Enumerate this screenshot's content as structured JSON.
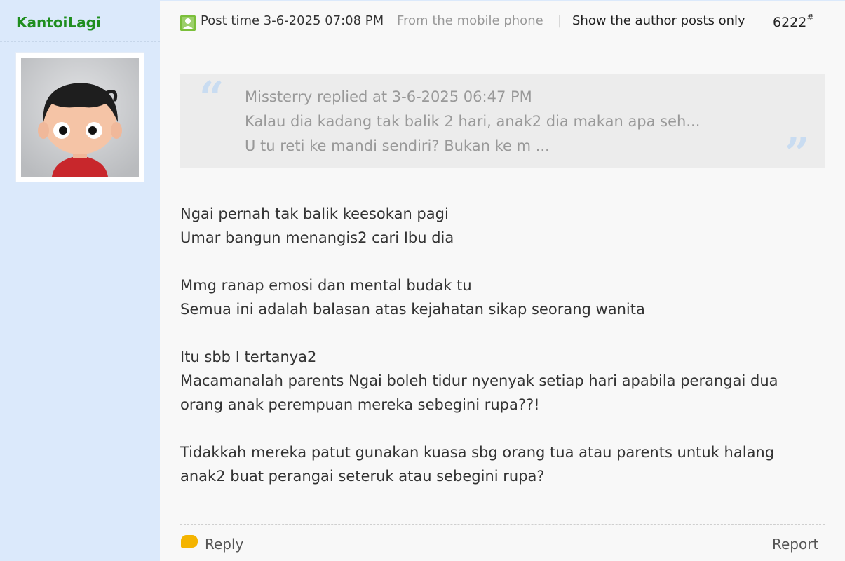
{
  "author": {
    "username": "KantoiLagi",
    "avatar_icon": "cartoon-boy-avatar"
  },
  "post_header": {
    "post_time": "Post time 3-6-2025 07:08 PM",
    "from": "From the mobile phone",
    "separator": "|",
    "author_only": "Show the author posts only",
    "floor_number": "6222",
    "floor_mark": "#"
  },
  "quote": {
    "line1": "Missterry replied at 3-6-2025 06:47 PM",
    "line2": "Kalau dia kadang tak balik 2 hari, anak2 dia makan apa seh...",
    "line3": "U tu reti ke mandi sendiri? Bukan ke m ..."
  },
  "body": {
    "p1_l1": "Ngai pernah tak balik keesokan pagi",
    "p1_l2": "Umar bangun menangis2 cari Ibu dia",
    "p2_l1": "Mmg ranap emosi dan mental budak tu",
    "p2_l2": "Semua ini adalah balasan atas kejahatan sikap seorang wanita",
    "p3_l1": "Itu sbb I tertanya2",
    "p3_l2": "Macamanalah parents Ngai boleh tidur nyenyak setiap hari apabila perangai dua",
    "p3_l3": "orang anak perempuan mereka sebegini rupa??!",
    "p4_l1": "Tidakkah mereka patut gunakan kuasa sbg orang tua atau parents untuk halang",
    "p4_l2": "anak2 buat perangai seteruk atau sebegini rupa?"
  },
  "footer": {
    "reply": "Reply",
    "report": "Report"
  },
  "colors": {
    "sidebar_bg": "#dbe9fb",
    "username": "#1f8e1f",
    "quote_bg": "#ececec",
    "quote_mark": "#c9dcf1",
    "reply_icon": "#f4b400"
  }
}
